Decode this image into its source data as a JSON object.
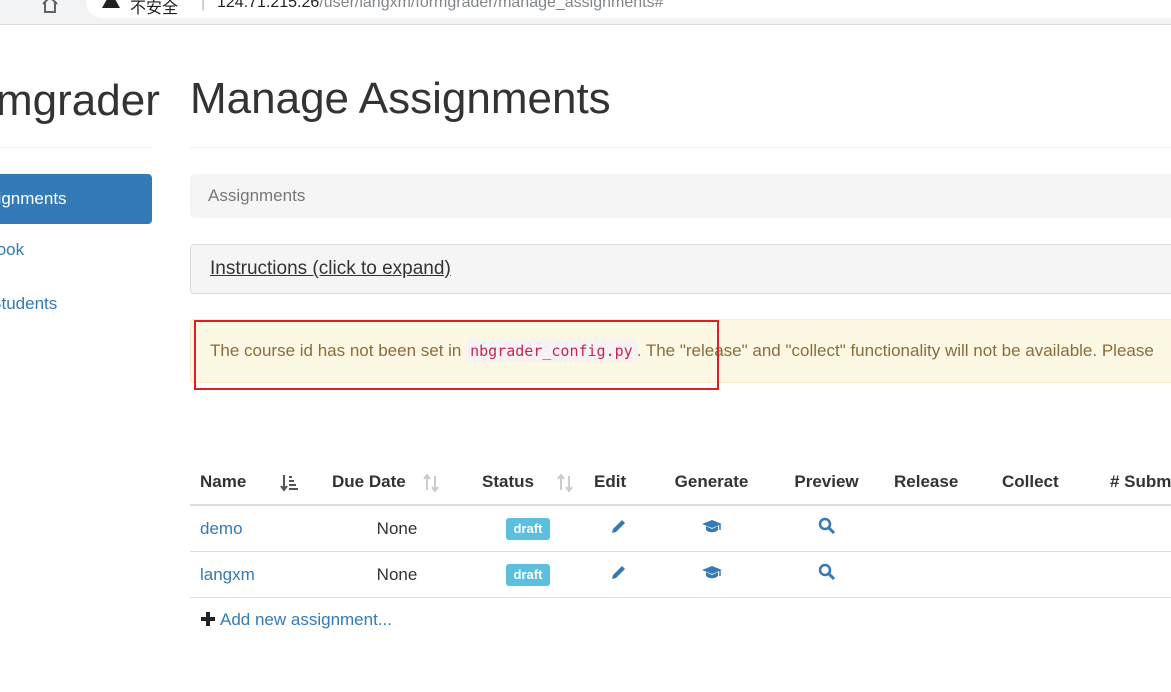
{
  "browser": {
    "security_text": "不安全",
    "divider": "|",
    "url_host": "124.71.215.26",
    "url_path": "/user/langxm/formgrader/manage_assignments#"
  },
  "sidebar": {
    "brand": "Formgrader",
    "items": [
      {
        "label": "Manage Assignments",
        "active": true
      },
      {
        "label": "Gradebook",
        "active": false
      },
      {
        "label": "Manage Students",
        "active": false
      }
    ]
  },
  "main": {
    "title": "Manage Assignments",
    "breadcrumb": "Assignments",
    "instructions_link": "Instructions (click to expand)",
    "alert": {
      "prefix": "The course id has not been set in",
      "code": "nbgrader_config.py",
      "suffix": ". The \"release\" and \"collect\" functionality will not be available. Please"
    },
    "table": {
      "headers": {
        "name": "Name",
        "due_date": "Due Date",
        "status": "Status",
        "edit": "Edit",
        "generate": "Generate",
        "preview": "Preview",
        "release": "Release",
        "collect": "Collect",
        "submissions": "# Submissions"
      },
      "rows": [
        {
          "name": "demo",
          "due_date": "None",
          "status": "draft"
        },
        {
          "name": "langxm",
          "due_date": "None",
          "status": "draft"
        }
      ]
    },
    "add_label": "Add new assignment..."
  },
  "colors": {
    "primary": "#337ab7",
    "alert_bg": "#fcf8e3",
    "alert_text": "#8a6d3b",
    "label_info": "#5bc0de",
    "highlight": "#e02020"
  },
  "icons": {
    "home": "home-icon",
    "warning": "warning-icon",
    "sort": "sort-icon",
    "edit": "pencil-icon",
    "generate": "graduation-cap-icon",
    "preview": "search-icon",
    "add": "plus-icon"
  }
}
